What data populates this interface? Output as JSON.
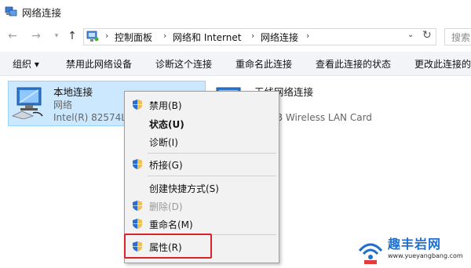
{
  "window": {
    "title": "网络连接"
  },
  "nav": {
    "back_icon": "arrow-left-icon",
    "forward_icon": "arrow-right-icon",
    "recent_icon": "chevron-down-icon",
    "up_icon": "arrow-up-icon",
    "breadcrumbs": [
      "控制面板",
      "网络和 Internet",
      "网络连接"
    ],
    "search_placeholder": "搜索"
  },
  "toolbar": {
    "items": [
      "组织 ▾",
      "禁用此网络设备",
      "诊断这个连接",
      "重命名此连接",
      "查看此连接的状态",
      "更改此连接的设置"
    ]
  },
  "connections": {
    "local": {
      "name": "本地连接",
      "type": "网络",
      "adapter": "Intel(R) 82574L"
    },
    "wifi": {
      "name": "无线网络连接",
      "adapter": "n USB Wireless LAN Card"
    }
  },
  "context_menu": {
    "items": [
      {
        "label": "禁用(B)",
        "shield": true
      },
      {
        "label": "状态(U)",
        "bold": true
      },
      {
        "label": "诊断(I)"
      },
      {
        "label": "桥接(G)",
        "shield": true
      },
      {
        "label": "创建快捷方式(S)"
      },
      {
        "label": "删除(D)",
        "shield": true,
        "disabled": true
      },
      {
        "label": "重命名(M)",
        "shield": true
      },
      {
        "label": "属性(R)",
        "shield": true,
        "highlighted": true
      }
    ]
  },
  "watermark": {
    "title": "趣丰岩网",
    "url": "www.yueyangbang.com"
  },
  "colors": {
    "selection": "#cce8ff",
    "highlight_border": "#d9232d",
    "accent": "#1f6fd0"
  }
}
